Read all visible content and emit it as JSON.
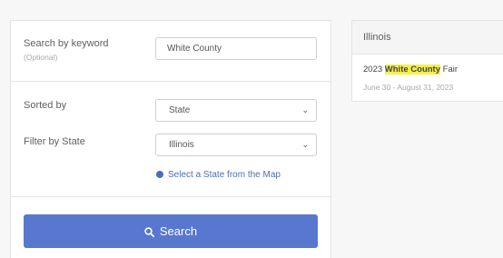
{
  "form": {
    "keyword_label": "Search by keyword",
    "keyword_optional": "(Optional)",
    "keyword_value": "White County",
    "sorted_label": "Sorted by",
    "sorted_value": "State",
    "filter_label": "Filter by State",
    "filter_value": "Illinois",
    "map_link": "Select a State from the Map",
    "search_label": "Search"
  },
  "results": {
    "state_heading": "Illinois",
    "items": [
      {
        "title_prefix": "2023",
        "title_highlight": "White County",
        "title_suffix": "Fair",
        "dates": "June 30 - August 31, 2023"
      }
    ]
  },
  "icons": {
    "select_chevron": "chevron-down-icon",
    "map_link_icon": "globe-icon",
    "search_icon": "search-icon"
  },
  "colors": {
    "button": "#5878cf",
    "link": "#4a6fb5",
    "highlight": "#f3f04a"
  }
}
